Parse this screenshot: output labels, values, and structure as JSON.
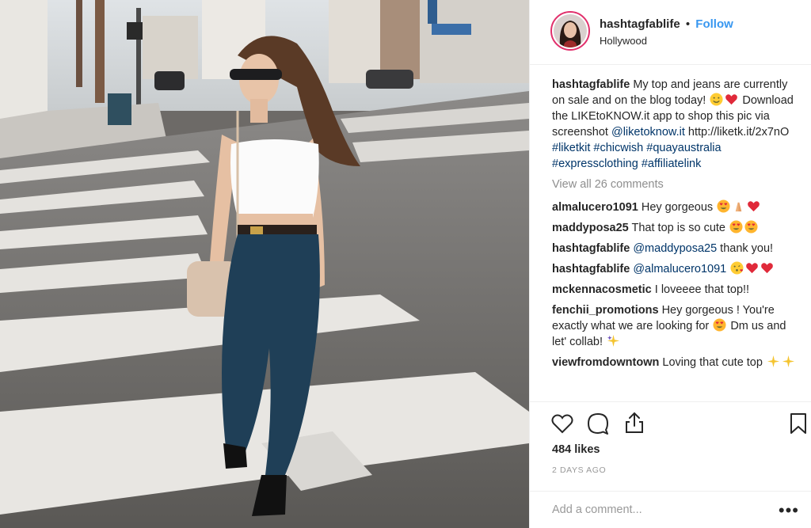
{
  "post": {
    "username": "hashtagfablife",
    "dot": "•",
    "follow_label": "Follow",
    "location": "Hollywood"
  },
  "caption": {
    "username": "hashtagfablife",
    "text_1": "My top and jeans are currently on sale and on the blog today!",
    "text_2": "Download the LIKEtoKNOW.it app to shop this pic via screenshot",
    "mention": "@liketoknow.it",
    "url": "http://liketk.it/2x7nO",
    "hashtags": [
      "#liketkit",
      "#chicwish",
      "#quayaustralia",
      "#expressclothing",
      "#affiliatelink"
    ]
  },
  "view_all": "View all 26 comments",
  "comments": [
    {
      "user": "almalucero1091",
      "text": "Hey gorgeous"
    },
    {
      "user": "maddyposa25",
      "text": "That top is so cute"
    },
    {
      "user": "hashtagfablife",
      "mention": "@maddyposa25",
      "text": "thank you!"
    },
    {
      "user": "hashtagfablife",
      "mention": "@almalucero1091",
      "text": ""
    },
    {
      "user": "mckennacosmetic",
      "text": "I loveeee that top!!"
    },
    {
      "user": "fenchii_promotions",
      "text": "Hey gorgeous ! You're exactly what we are looking for",
      "text_2": "Dm us and let' collab!"
    },
    {
      "user": "viewfromdowntown",
      "text": "Loving that cute top"
    }
  ],
  "likes": "484 likes",
  "time": "2 DAYS AGO",
  "add_comment_placeholder": "Add a comment...",
  "more_label": "•••",
  "icons": {
    "like": "heart-icon",
    "comment": "comment-icon",
    "share": "share-icon",
    "save": "bookmark-icon"
  },
  "colors": {
    "link": "#003569",
    "follow": "#3897f0",
    "muted": "#8e8e8e",
    "text": "#262626"
  }
}
